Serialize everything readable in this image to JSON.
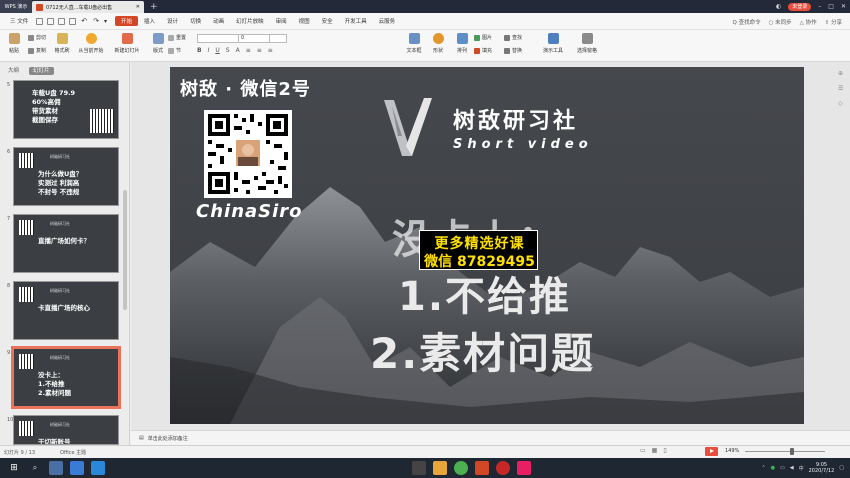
{
  "tabbar": {
    "app_label": "WPS 演示",
    "doc_title": "0712无人直...车载U盘必出售",
    "login": "未登录"
  },
  "menu": {
    "file": "三 文件",
    "items": [
      "开始",
      "插入",
      "设计",
      "切换",
      "动画",
      "幻灯片放映",
      "审阅",
      "视图",
      "安全",
      "开发工具",
      "云服务"
    ],
    "active_index": 0,
    "search": "Q 查找命令",
    "right_icons": [
      "○ 未同步",
      "△ 协作",
      "⇧ 分享"
    ]
  },
  "ribbon": {
    "paste": "粘贴",
    "cut": "剪切",
    "copy": "复制",
    "format_painter": "格式刷",
    "from_current": "从当前开始",
    "new_slide": "新建幻灯片",
    "layout": "版式",
    "section": "节",
    "reset": "重置",
    "font_size": "0",
    "textbox": "文本框",
    "shape": "形状",
    "arrange": "排列",
    "picture": "图片",
    "fill": "填充",
    "outline": "轮廓",
    "find": "查找",
    "replace": "替换",
    "slideshow": "演示工具",
    "select_pane": "选择窗格"
  },
  "sidebar": {
    "tab_outline": "大纲",
    "tab_slides": "幻灯片",
    "thumbnails": [
      {
        "num": "5",
        "lines": [
          "车载U盘 79.9",
          "60%高佣",
          "带货素材",
          "截图保存"
        ]
      },
      {
        "num": "6",
        "lines": [
          "为什么做U盘？",
          "实测过 利润高",
          "不封号 不违规"
        ]
      },
      {
        "num": "7",
        "lines": [
          "直播广场如何卡？"
        ]
      },
      {
        "num": "8",
        "lines": [
          "卡直播广场的核心"
        ]
      },
      {
        "num": "9",
        "lines": [
          "没卡上：",
          "1.不给推",
          "2.素材问题"
        ]
      },
      {
        "num": "10",
        "lines": [
          "干切新账号"
        ]
      }
    ],
    "selected_index": 4,
    "mini_logo": "树敌研习社"
  },
  "slide": {
    "wechat_title": "树敌 · 微信2号",
    "brand_name": "树敌研习社",
    "brand_sub": "Short video",
    "chinasiro": "ChinaSiro",
    "heading": "没卡上：",
    "point1": "1.不给推",
    "point2": "2.素材问题",
    "promo_line1": "更多精选好课",
    "promo_line2": "微信  87829495"
  },
  "notes": {
    "placeholder": "单击此处添加备注"
  },
  "status": {
    "slide_pos": "幻灯片 9 / 13",
    "theme": "Office 主题",
    "zoom": "149%"
  },
  "taskbar": {
    "time": "9:05",
    "date": "2020/7/12",
    "lang": "中"
  }
}
